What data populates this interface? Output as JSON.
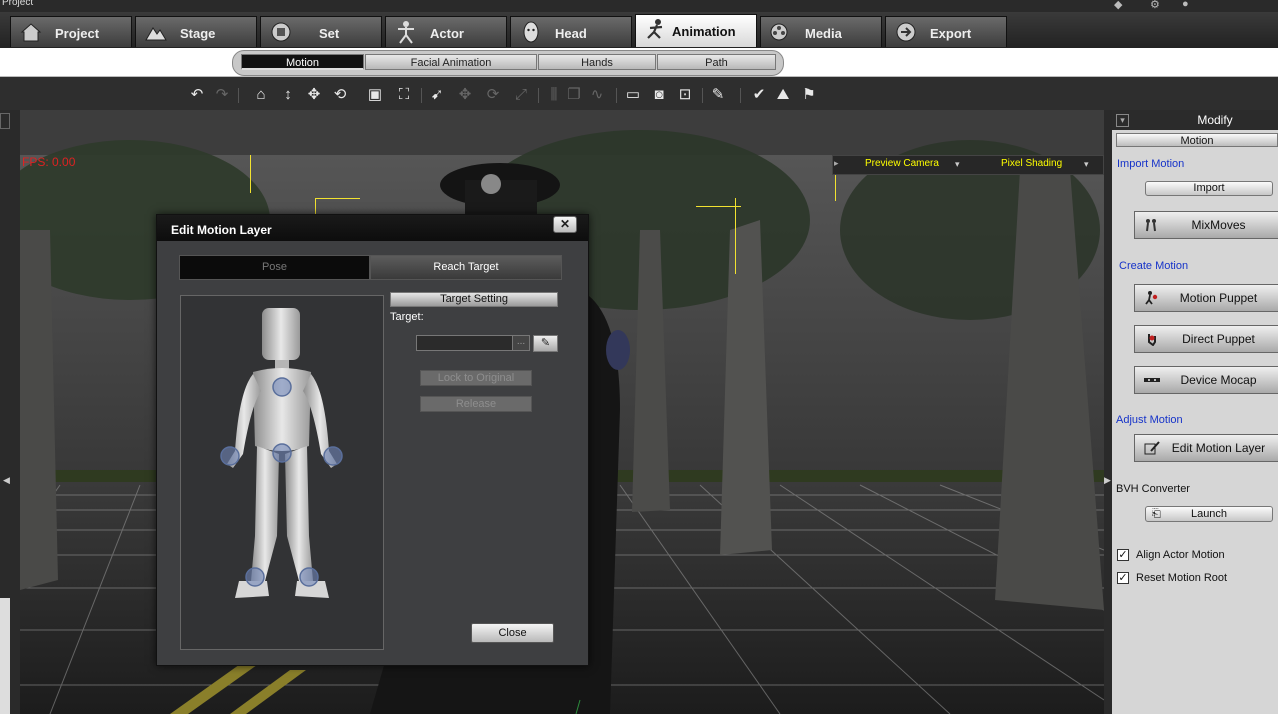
{
  "window": {
    "title": "Project"
  },
  "main_tabs": [
    {
      "label": "Project",
      "icon": "project-icon"
    },
    {
      "label": "Stage",
      "icon": "stage-icon"
    },
    {
      "label": "Set",
      "icon": "set-icon"
    },
    {
      "label": "Actor",
      "icon": "actor-icon"
    },
    {
      "label": "Head",
      "icon": "head-icon"
    },
    {
      "label": "Animation",
      "icon": "animation-icon",
      "active": true
    },
    {
      "label": "Media",
      "icon": "media-icon"
    },
    {
      "label": "Export",
      "icon": "export-icon"
    }
  ],
  "sub_tabs": [
    {
      "label": "Motion",
      "active": true
    },
    {
      "label": "Facial Animation"
    },
    {
      "label": "Hands"
    },
    {
      "label": "Path"
    }
  ],
  "viewport": {
    "fps": "FPS: 0.00",
    "camera": "Preview Camera",
    "shading": "Pixel Shading"
  },
  "dialog": {
    "title": "Edit Motion Layer",
    "close_glyph": "✕",
    "tabs": {
      "pose": "Pose",
      "reach": "Reach Target"
    },
    "target_setting": "Target Setting",
    "target_label": "Target:",
    "target_value": "",
    "browse_glyph": "...",
    "lock_button": "Lock to Original",
    "release_button": "Release",
    "close_button": "Close"
  },
  "panel": {
    "header": "Modify",
    "collapse_glyph": "▾",
    "subheader": "Motion",
    "import_section": "Import Motion",
    "import_button": "Import",
    "mixmoves_button": "MixMoves",
    "create_section": "Create Motion",
    "motion_puppet_button": "Motion Puppet",
    "direct_puppet_button": "Direct Puppet",
    "device_mocap_button": "Device Mocap",
    "adjust_section": "Adjust Motion",
    "edit_motion_layer_button": "Edit Motion Layer",
    "bvh_section": "BVH Converter",
    "launch_button": "Launch",
    "align_actor_motion": {
      "label": "Align Actor Motion",
      "checked": true
    },
    "reset_motion_root": {
      "label": "Reset Motion Root",
      "checked": true
    }
  },
  "colors": {
    "link_blue": "#1633c9",
    "fps_red": "#dd2222",
    "overlay_yellow": "#ffff00",
    "effector_blue": "#6f86b8"
  }
}
